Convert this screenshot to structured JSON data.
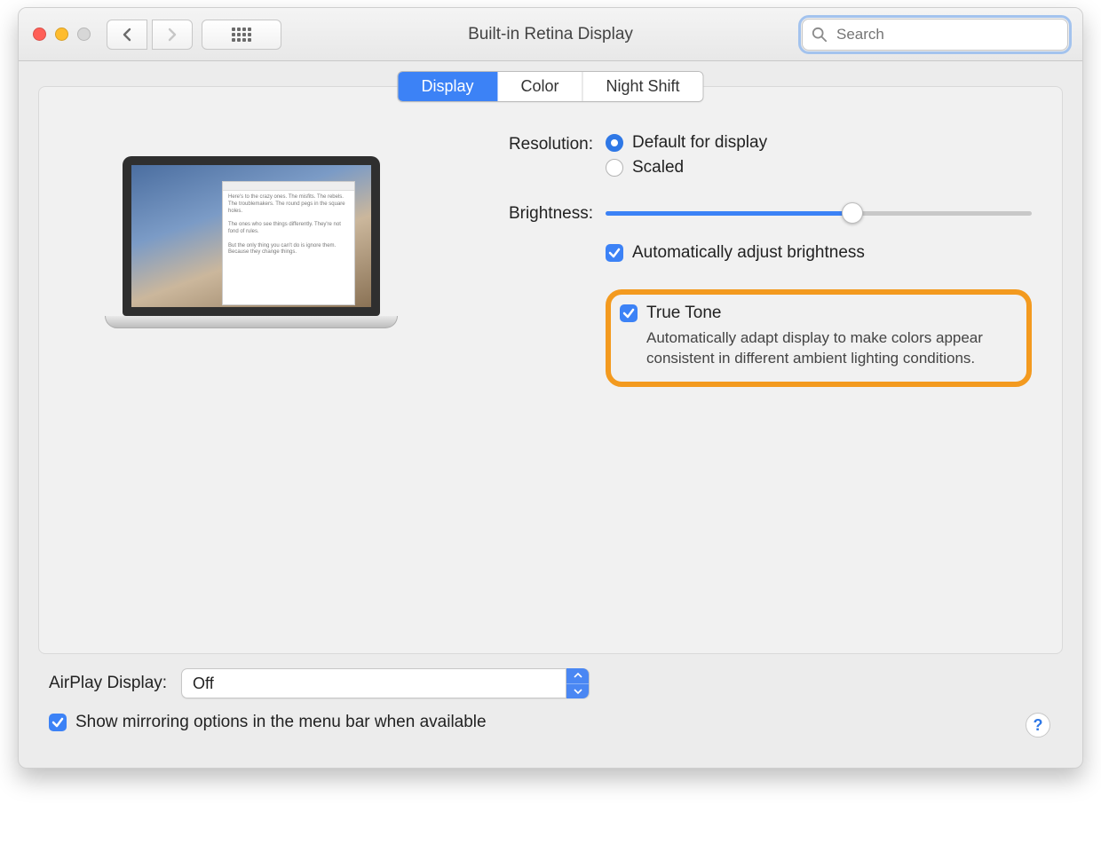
{
  "window": {
    "title": "Built-in Retina Display"
  },
  "toolbar": {
    "search_placeholder": "Search"
  },
  "tabs": {
    "display": "Display",
    "color": "Color",
    "night_shift": "Night Shift",
    "active": "display"
  },
  "settings": {
    "resolution_label": "Resolution:",
    "resolution_default": "Default for display",
    "resolution_scaled": "Scaled",
    "resolution_selected": "default",
    "brightness_label": "Brightness:",
    "brightness_value": 58,
    "auto_brightness_label": "Automatically adjust brightness",
    "auto_brightness_checked": true,
    "true_tone_label": "True Tone",
    "true_tone_checked": true,
    "true_tone_description": "Automatically adapt display to make colors appear consistent in different ambient lighting conditions."
  },
  "footer": {
    "airplay_label": "AirPlay Display:",
    "airplay_value": "Off",
    "mirroring_label": "Show mirroring options in the menu bar when available",
    "mirroring_checked": true
  }
}
